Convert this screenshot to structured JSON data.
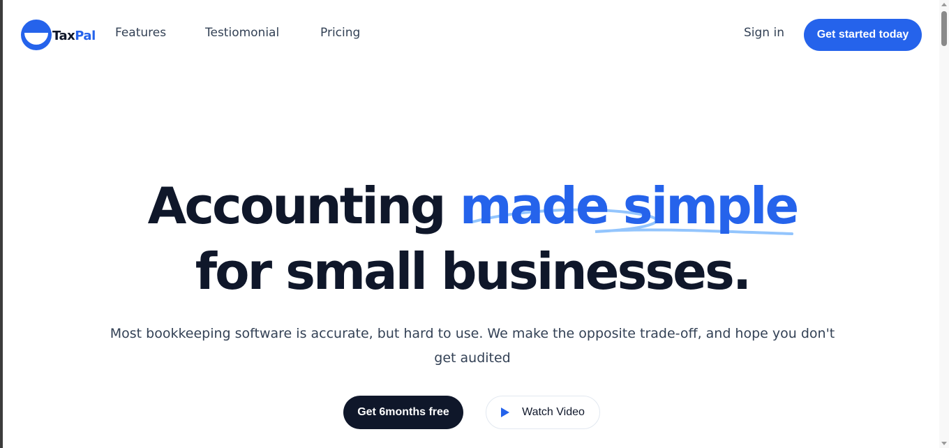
{
  "header": {
    "logo": {
      "part1": "Tax",
      "part2": "Pal",
      "icon": "logo-mark-icon"
    },
    "nav": [
      {
        "label": "Features"
      },
      {
        "label": "Testiomonial"
      },
      {
        "label": "Pricing"
      }
    ],
    "signin_label": "Sign in",
    "cta_label": "Get started today"
  },
  "hero": {
    "title_prefix": "Accounting",
    "title_highlight": "made simple",
    "title_line2": "for small businesses.",
    "subtitle": "Most bookkeeping software is accurate, but hard to use. We make the opposite trade-off, and hope you don't get audited",
    "primary_button": "Get 6months free",
    "video_button": "Watch Video",
    "video_icon": "play-icon"
  },
  "colors": {
    "accent": "#2563eb",
    "dark": "#0f172a",
    "scribble": "#93c5fd",
    "text": "#334155"
  }
}
